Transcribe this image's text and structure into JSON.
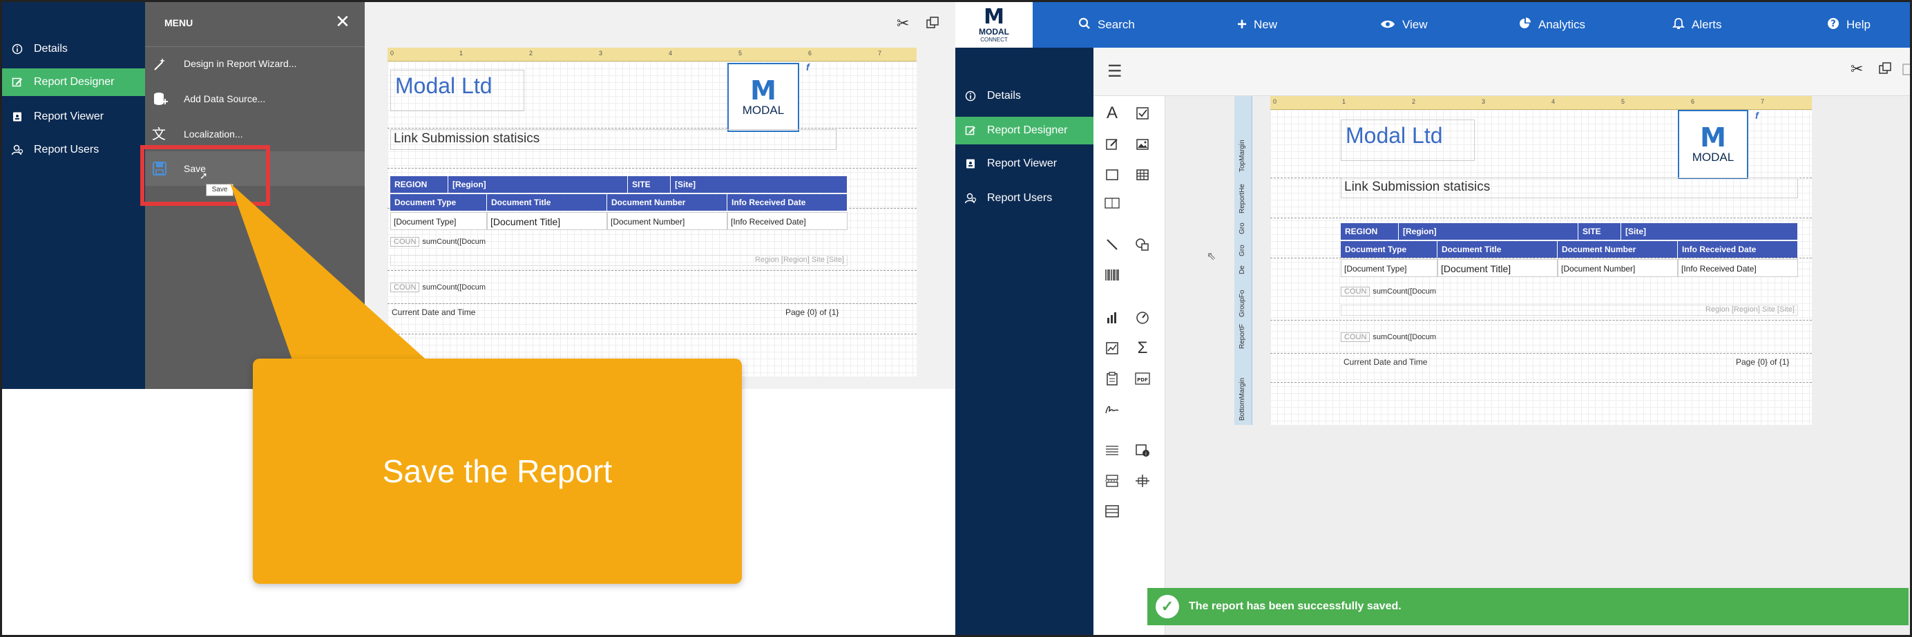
{
  "left_panel": {
    "sidebar": {
      "items": [
        {
          "label": "Details",
          "icon": "info-icon"
        },
        {
          "label": "Report Designer",
          "icon": "edit-icon"
        },
        {
          "label": "Report Viewer",
          "icon": "report-icon"
        },
        {
          "label": "Report Users",
          "icon": "users-icon"
        }
      ]
    },
    "menu": {
      "title": "MENU",
      "close_icon": "close-icon",
      "items": [
        {
          "label": "Design in Report Wizard...",
          "icon": "wand-icon"
        },
        {
          "label": "Add Data Source...",
          "icon": "database-add-icon"
        },
        {
          "label": "Localization...",
          "icon": "translate-icon"
        },
        {
          "label": "Save",
          "icon": "save-icon"
        }
      ],
      "tooltip": "Save"
    }
  },
  "callout": {
    "text": "Save the Report",
    "color": "#f4a912"
  },
  "report": {
    "title": "Modal Ltd",
    "subtitle": "Link Submission statisics",
    "logo_letter": "M",
    "logo_text": "MODAL",
    "func_glyph": "f",
    "ruler_ticks": [
      "0",
      "1",
      "2",
      "3",
      "4",
      "5",
      "6",
      "7"
    ],
    "group_header": {
      "region_label": "REGION",
      "region_value": "[Region]",
      "site_label": "SITE",
      "site_value": "[Site]"
    },
    "columns": [
      "Document Type",
      "Document Title",
      "Document Number",
      "Info Received Date"
    ],
    "cells": [
      "[Document Type]",
      "[Document Title]",
      "[Document Number]",
      "[Info Received Date]"
    ],
    "count_label": "COUN",
    "count_expr": "sumCount([Docum",
    "group_footer": "Region [Region] Site [Site]",
    "footer_left": "Current Date and Time",
    "footer_right": "Page {0} of {1}",
    "band_names": [
      "TopMargin",
      "ReportHe",
      "Gro",
      "Gro",
      "De",
      "GroupFo",
      "ReportF",
      "BottomMargin"
    ]
  },
  "right_panel": {
    "logo": {
      "mark": "M",
      "name": "MODAL",
      "sub": "CONNECT"
    },
    "nav": [
      {
        "label": "Search",
        "icon": "search-icon"
      },
      {
        "label": "New",
        "icon": "plus-icon"
      },
      {
        "label": "View",
        "icon": "eye-icon"
      },
      {
        "label": "Analytics",
        "icon": "pie-chart-icon"
      },
      {
        "label": "Alerts",
        "icon": "bell-icon"
      },
      {
        "label": "Help",
        "icon": "help-icon"
      }
    ],
    "sidebar": {
      "items": [
        {
          "label": "Details"
        },
        {
          "label": "Report Designer"
        },
        {
          "label": "Report Viewer"
        },
        {
          "label": "Report Users"
        }
      ]
    },
    "toast": "The report has been successfully saved."
  },
  "colors": {
    "navy": "#0b2a52",
    "green": "#43b56a",
    "blue": "#1f66c5",
    "header": "#3f57b5",
    "highlight": "#e23a3a"
  }
}
